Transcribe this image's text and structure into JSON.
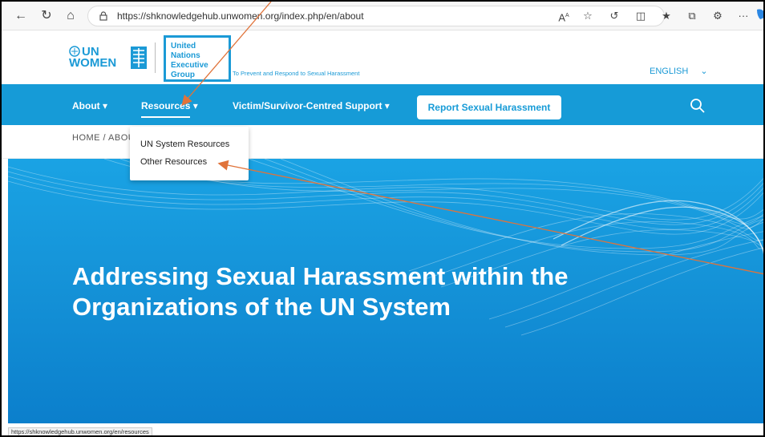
{
  "browser": {
    "url": "https://shknowledgehub.unwomen.org/index.php/en/about",
    "status_url": "https://shknowledgehub.unwomen.org/en/resources",
    "icons": [
      "back-icon",
      "refresh-icon",
      "home-icon",
      "lock-icon",
      "read-aloud-icon",
      "favorite-star-icon",
      "extension-icon",
      "split-screen-icon",
      "favorites-icon",
      "collections-icon",
      "profile-icon",
      "more-icon",
      "copilot-icon"
    ],
    "more_label": "···",
    "read_aloud_label": "A",
    "read_aloud_sup": "A"
  },
  "header": {
    "logo_line1": "UN",
    "logo_line2": "WOMEN",
    "exec_group_lines": [
      "United Nations",
      "Executive",
      "Group"
    ],
    "tagline": "To Prevent and Respond to Sexual Harassment",
    "language": "ENGLISH"
  },
  "nav": {
    "items": [
      {
        "label": "About ▾"
      },
      {
        "label": "Resources ▾"
      },
      {
        "label": "Victim/Survivor-Centred Support ▾"
      }
    ],
    "report_button": "Report Sexual Harassment"
  },
  "breadcrumb": {
    "text": "HOME / ABOU"
  },
  "dropdown": {
    "items": [
      "UN System Resources",
      "Other Resources"
    ]
  },
  "hero": {
    "title": "Addressing Sexual Harassment within the Organizations of the UN System"
  },
  "colors": {
    "brand_blue": "#169bd7",
    "annotation_arrow": "#e0733a"
  }
}
